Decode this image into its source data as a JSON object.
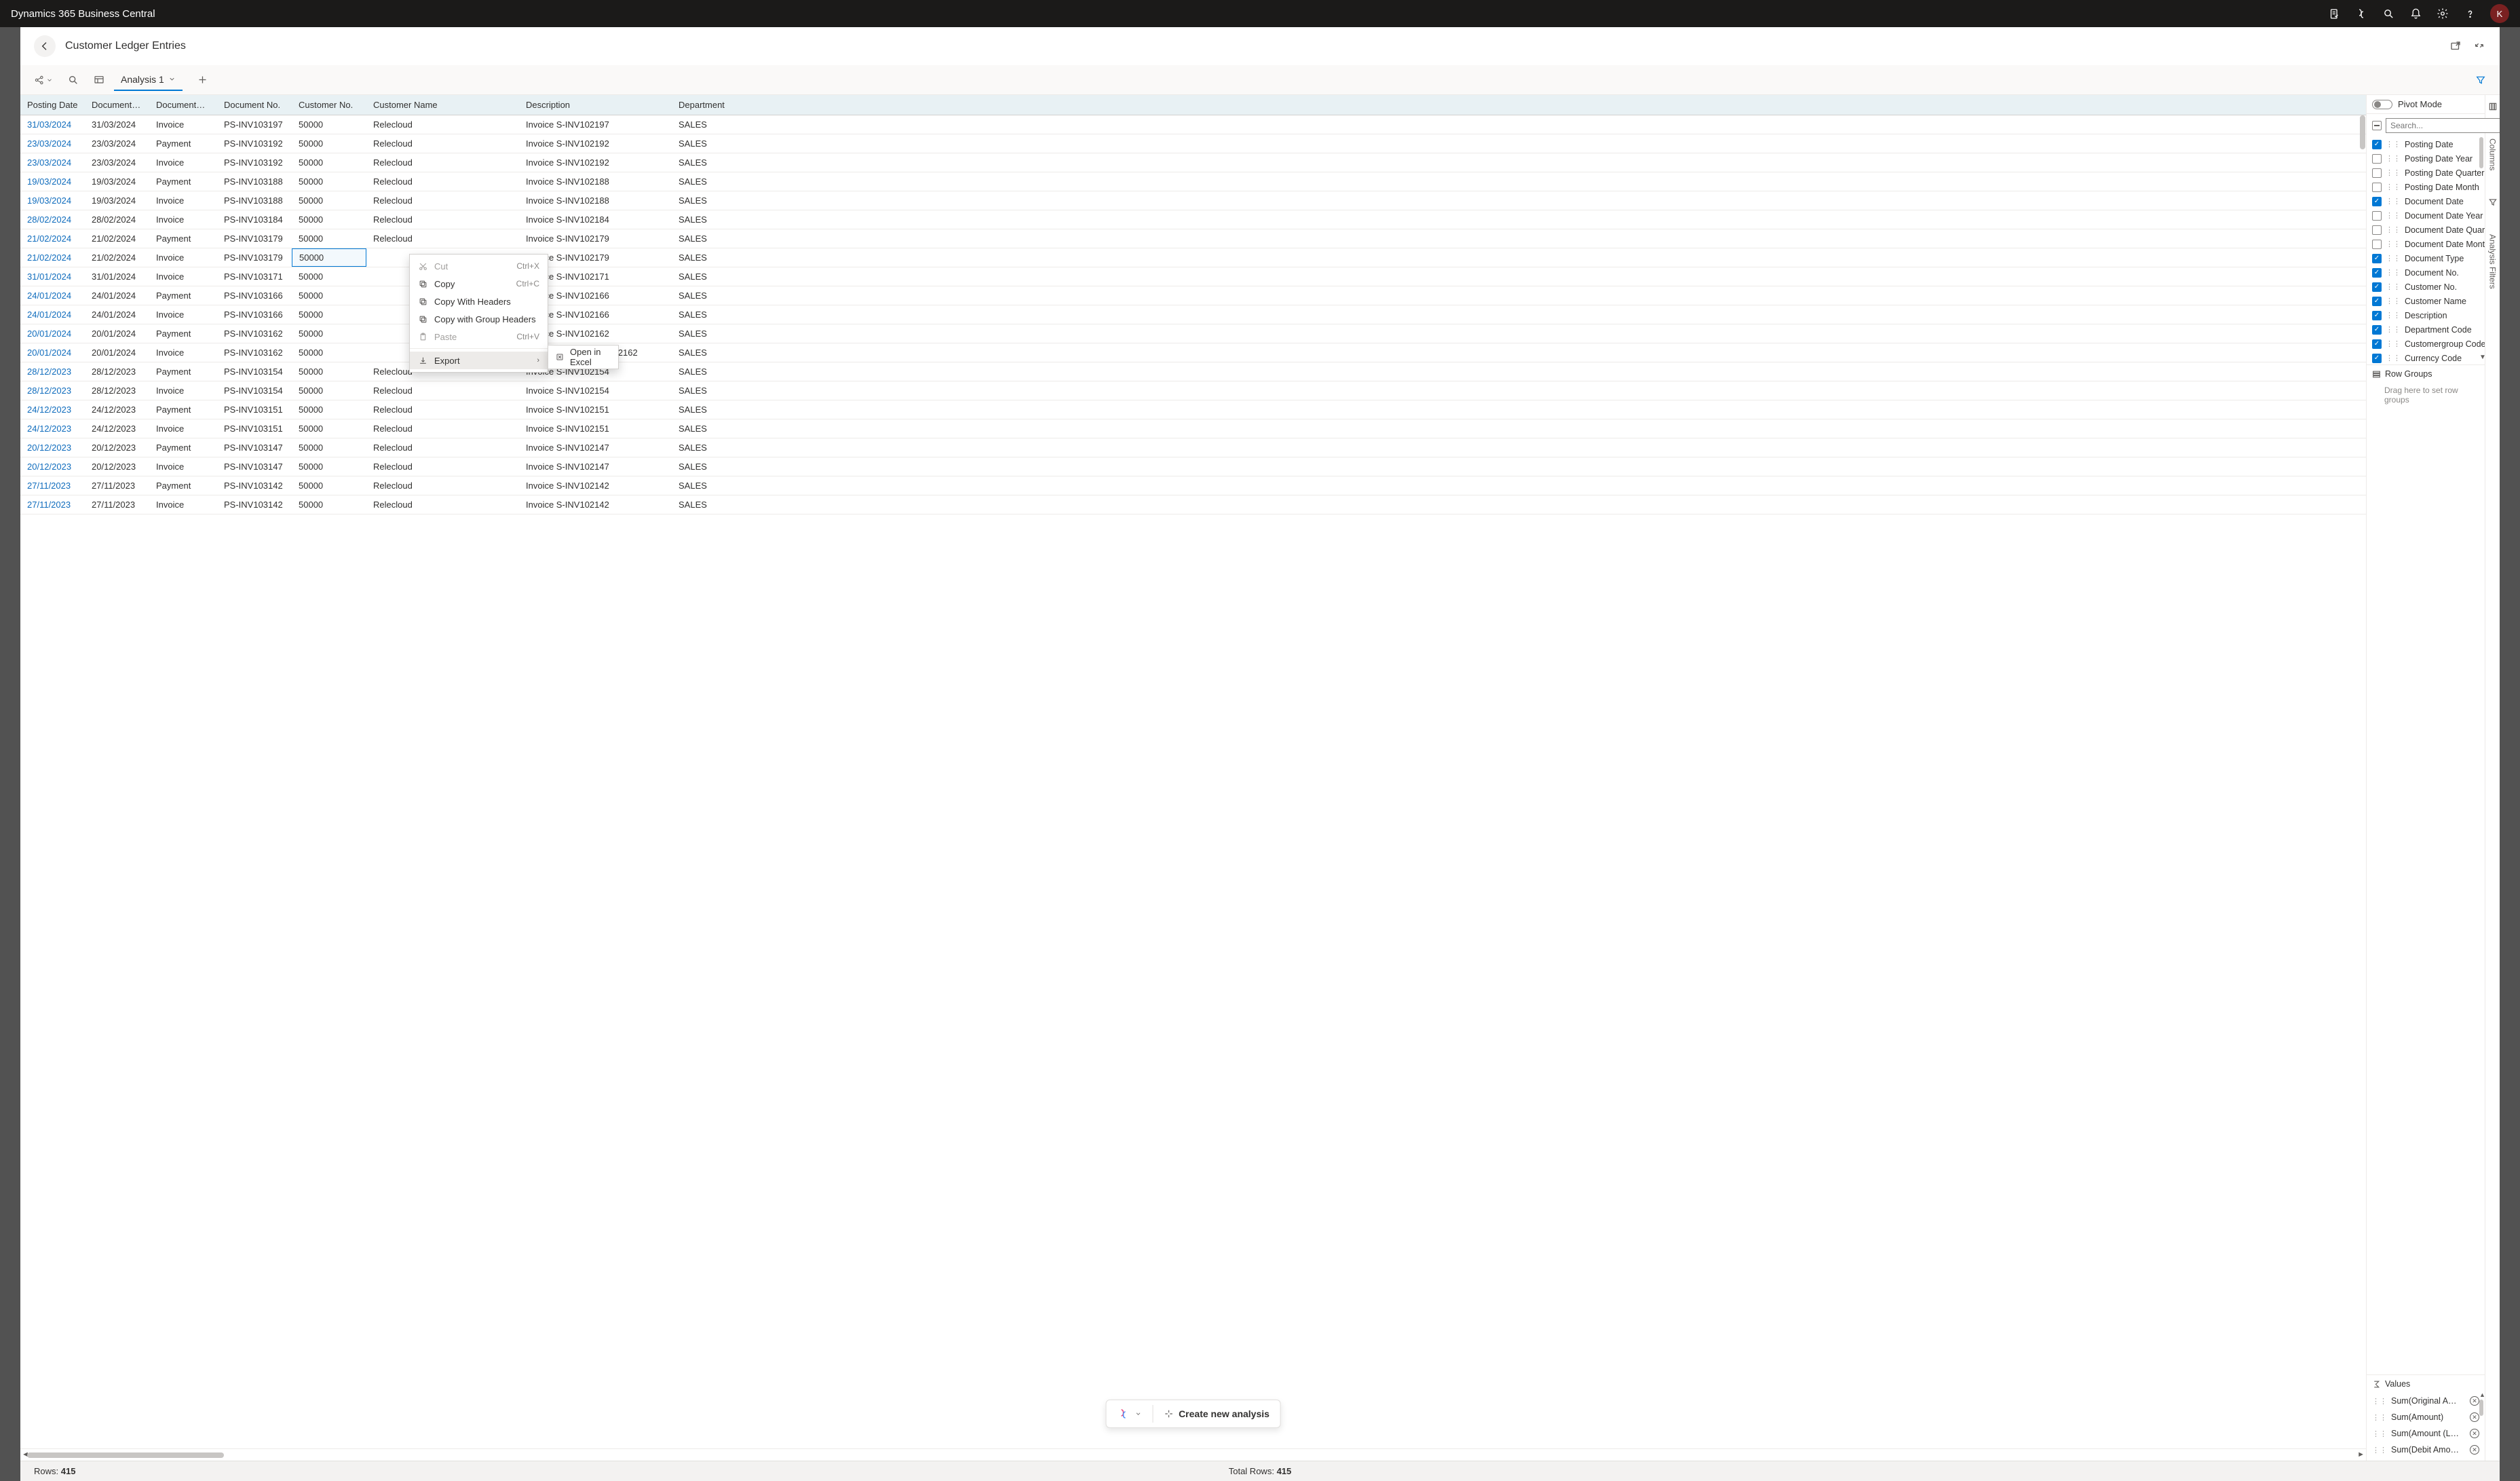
{
  "app_title": "Dynamics 365 Business Central",
  "avatar_letter": "K",
  "page": {
    "title": "Customer Ledger Entries"
  },
  "toolbar": {
    "analysis_tab": "Analysis 1"
  },
  "columns": {
    "posting_date": "Posting Date",
    "document_date": "Document…",
    "document_type": "Document…",
    "document_no": "Document No.",
    "customer_no": "Customer No.",
    "customer_name": "Customer Name",
    "description": "Description",
    "department": "Department…"
  },
  "rows": [
    {
      "pd": "31/03/2024",
      "dd": "31/03/2024",
      "dt": "Invoice",
      "dn": "PS-INV103197",
      "cn": "50000",
      "cname": "Relecloud",
      "desc": "Invoice S-INV102197",
      "dept": "SALES"
    },
    {
      "pd": "23/03/2024",
      "dd": "23/03/2024",
      "dt": "Payment",
      "dn": "PS-INV103192",
      "cn": "50000",
      "cname": "Relecloud",
      "desc": "Invoice S-INV102192",
      "dept": "SALES"
    },
    {
      "pd": "23/03/2024",
      "dd": "23/03/2024",
      "dt": "Invoice",
      "dn": "PS-INV103192",
      "cn": "50000",
      "cname": "Relecloud",
      "desc": "Invoice S-INV102192",
      "dept": "SALES"
    },
    {
      "pd": "19/03/2024",
      "dd": "19/03/2024",
      "dt": "Payment",
      "dn": "PS-INV103188",
      "cn": "50000",
      "cname": "Relecloud",
      "desc": "Invoice S-INV102188",
      "dept": "SALES"
    },
    {
      "pd": "19/03/2024",
      "dd": "19/03/2024",
      "dt": "Invoice",
      "dn": "PS-INV103188",
      "cn": "50000",
      "cname": "Relecloud",
      "desc": "Invoice S-INV102188",
      "dept": "SALES"
    },
    {
      "pd": "28/02/2024",
      "dd": "28/02/2024",
      "dt": "Invoice",
      "dn": "PS-INV103184",
      "cn": "50000",
      "cname": "Relecloud",
      "desc": "Invoice S-INV102184",
      "dept": "SALES"
    },
    {
      "pd": "21/02/2024",
      "dd": "21/02/2024",
      "dt": "Payment",
      "dn": "PS-INV103179",
      "cn": "50000",
      "cname": "Relecloud",
      "desc": "Invoice S-INV102179",
      "dept": "SALES"
    },
    {
      "pd": "21/02/2024",
      "dd": "21/02/2024",
      "dt": "Invoice",
      "dn": "PS-INV103179",
      "cn": "50000",
      "cname": "",
      "desc": "Invoice S-INV102179",
      "dept": "SALES",
      "sel": true
    },
    {
      "pd": "31/01/2024",
      "dd": "31/01/2024",
      "dt": "Invoice",
      "dn": "PS-INV103171",
      "cn": "50000",
      "cname": "",
      "desc": "Invoice S-INV102171",
      "dept": "SALES"
    },
    {
      "pd": "24/01/2024",
      "dd": "24/01/2024",
      "dt": "Payment",
      "dn": "PS-INV103166",
      "cn": "50000",
      "cname": "",
      "desc": "Invoice S-INV102166",
      "dept": "SALES"
    },
    {
      "pd": "24/01/2024",
      "dd": "24/01/2024",
      "dt": "Invoice",
      "dn": "PS-INV103166",
      "cn": "50000",
      "cname": "",
      "desc": "Invoice S-INV102166",
      "dept": "SALES"
    },
    {
      "pd": "20/01/2024",
      "dd": "20/01/2024",
      "dt": "Payment",
      "dn": "PS-INV103162",
      "cn": "50000",
      "cname": "",
      "desc": "Invoice S-INV102162",
      "dept": "SALES"
    },
    {
      "pd": "20/01/2024",
      "dd": "20/01/2024",
      "dt": "Invoice",
      "dn": "PS-INV103162",
      "cn": "50000",
      "cname": "",
      "desc": "S-INV102162",
      "dept": "SALES",
      "trunc": true
    },
    {
      "pd": "28/12/2023",
      "dd": "28/12/2023",
      "dt": "Payment",
      "dn": "PS-INV103154",
      "cn": "50000",
      "cname": "Relecloud",
      "desc": "Invoice S-INV102154",
      "dept": "SALES"
    },
    {
      "pd": "28/12/2023",
      "dd": "28/12/2023",
      "dt": "Invoice",
      "dn": "PS-INV103154",
      "cn": "50000",
      "cname": "Relecloud",
      "desc": "Invoice S-INV102154",
      "dept": "SALES"
    },
    {
      "pd": "24/12/2023",
      "dd": "24/12/2023",
      "dt": "Payment",
      "dn": "PS-INV103151",
      "cn": "50000",
      "cname": "Relecloud",
      "desc": "Invoice S-INV102151",
      "dept": "SALES"
    },
    {
      "pd": "24/12/2023",
      "dd": "24/12/2023",
      "dt": "Invoice",
      "dn": "PS-INV103151",
      "cn": "50000",
      "cname": "Relecloud",
      "desc": "Invoice S-INV102151",
      "dept": "SALES"
    },
    {
      "pd": "20/12/2023",
      "dd": "20/12/2023",
      "dt": "Payment",
      "dn": "PS-INV103147",
      "cn": "50000",
      "cname": "Relecloud",
      "desc": "Invoice S-INV102147",
      "dept": "SALES"
    },
    {
      "pd": "20/12/2023",
      "dd": "20/12/2023",
      "dt": "Invoice",
      "dn": "PS-INV103147",
      "cn": "50000",
      "cname": "Relecloud",
      "desc": "Invoice S-INV102147",
      "dept": "SALES"
    },
    {
      "pd": "27/11/2023",
      "dd": "27/11/2023",
      "dt": "Payment",
      "dn": "PS-INV103142",
      "cn": "50000",
      "cname": "Relecloud",
      "desc": "Invoice S-INV102142",
      "dept": "SALES"
    },
    {
      "pd": "27/11/2023",
      "dd": "27/11/2023",
      "dt": "Invoice",
      "dn": "PS-INV103142",
      "cn": "50000",
      "cname": "Relecloud",
      "desc": "Invoice S-INV102142",
      "dept": "SALES"
    }
  ],
  "context_menu": {
    "cut": "Cut",
    "cut_sc": "Ctrl+X",
    "copy": "Copy",
    "copy_sc": "Ctrl+C",
    "copy_headers": "Copy With Headers",
    "copy_group": "Copy with Group Headers",
    "paste": "Paste",
    "paste_sc": "Ctrl+V",
    "export": "Export",
    "open_excel": "Open in Excel"
  },
  "float": {
    "create": "Create new analysis"
  },
  "footer": {
    "rows_label": "Rows:",
    "rows_value": "415",
    "total_label": "Total Rows:",
    "total_value": "415"
  },
  "side": {
    "pivot_label": "Pivot Mode",
    "search_placeholder": "Search...",
    "fields": [
      {
        "label": "Posting Date",
        "checked": true
      },
      {
        "label": "Posting Date Year",
        "checked": false
      },
      {
        "label": "Posting Date Quarter",
        "checked": false
      },
      {
        "label": "Posting Date Month",
        "checked": false
      },
      {
        "label": "Document Date",
        "checked": true
      },
      {
        "label": "Document Date Year",
        "checked": false
      },
      {
        "label": "Document Date Quar…",
        "checked": false
      },
      {
        "label": "Document Date Month",
        "checked": false
      },
      {
        "label": "Document Type",
        "checked": true
      },
      {
        "label": "Document No.",
        "checked": true
      },
      {
        "label": "Customer No.",
        "checked": true
      },
      {
        "label": "Customer Name",
        "checked": true
      },
      {
        "label": "Description",
        "checked": true
      },
      {
        "label": "Department Code",
        "checked": true
      },
      {
        "label": "Customergroup Code",
        "checked": true
      },
      {
        "label": "Currency Code",
        "checked": true
      }
    ],
    "row_groups_label": "Row Groups",
    "row_groups_placeholder": "Drag here to set row groups",
    "values_label": "Values",
    "values": [
      "Sum(Original A…",
      "Sum(Amount)",
      "Sum(Amount (L…",
      "Sum(Debit Amo…"
    ],
    "tab_columns": "Columns",
    "tab_filters": "Analysis Filters"
  }
}
